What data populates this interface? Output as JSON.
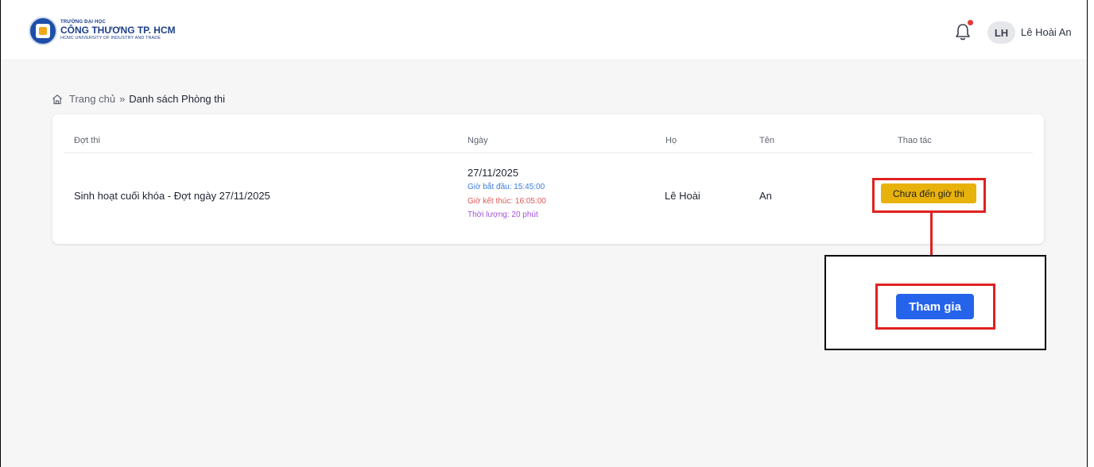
{
  "header": {
    "logo": {
      "line1": "TRƯỜNG ĐẠI HỌC",
      "line2": "CÔNG THƯƠNG TP. HCM",
      "line3": "HCMC UNIVERSITY OF INDUSTRY AND TRADE"
    },
    "notification_icon": "bell-icon",
    "user_initials": "LH",
    "user_name": "Lê Hoài An"
  },
  "breadcrumb": {
    "home": "Trang chủ",
    "separator": "»",
    "current": "Danh sách Phòng thi"
  },
  "table": {
    "columns": [
      "Đợt thi",
      "Ngày",
      "Họ",
      "Tên",
      "Thao tác"
    ],
    "rows": [
      {
        "exam": "Sinh hoạt cuối khóa - Đợt ngày 27/11/2025",
        "date": "27/11/2025",
        "start": "Giờ bắt đầu: 15:45:00",
        "end": "Giờ kết thúc: 16:05:00",
        "duration": "Thời lượng: 20 phút",
        "last_name": "Lê Hoài",
        "first_name": "An",
        "action": "Chưa đến giờ thi"
      }
    ]
  },
  "callout": {
    "join_label": "Tham gia"
  },
  "colors": {
    "status_button": "#e8b20d",
    "join_button": "#2563eb",
    "highlight": "#e02020",
    "start_time": "#3b7ce0",
    "end_time": "#e05656",
    "duration": "#a44fdd"
  }
}
